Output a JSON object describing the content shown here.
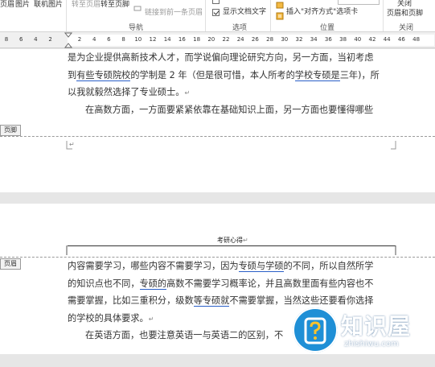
{
  "ribbon": {
    "items": [
      {
        "id": "header",
        "label": "页眉"
      },
      {
        "id": "pic",
        "label": "图片"
      },
      {
        "id": "online_pic",
        "label": "联机图片"
      },
      {
        "id": "goto_header",
        "label": "转至页眉"
      },
      {
        "id": "goto_footer",
        "label": "转至页脚"
      },
      {
        "id": "link_prev",
        "label": "链接到前一条页眉"
      },
      {
        "id": "show_doc_text",
        "label": "显示文档文字"
      },
      {
        "id": "insert_align_tab",
        "label": "插入\"对齐方式\"选项卡"
      },
      {
        "id": "close_label",
        "label": "关闭"
      },
      {
        "id": "close_hf",
        "label": "页眉和页脚"
      }
    ],
    "groups": {
      "navigation": "导航",
      "options": "选项",
      "position": "位置",
      "close": "关闭"
    }
  },
  "ruler": {
    "numbers": [
      "8",
      "6",
      "4",
      "2",
      "",
      "2",
      "4",
      "6",
      "8",
      "10",
      "12",
      "14",
      "16",
      "18",
      "20",
      "22",
      "24",
      "26",
      "28",
      "30",
      "32",
      "34",
      "36",
      "38",
      "40",
      "42",
      "44",
      "46",
      "48"
    ]
  },
  "page1": {
    "lines": [
      {
        "parts": [
          {
            "t": "是为企业提供高新技术人才，而学说偏向理论研究方向，另一方面，当初考虑"
          }
        ]
      },
      {
        "parts": [
          {
            "t": "到"
          },
          {
            "t": "有些专硕院校",
            "u": true
          },
          {
            "t": "的学制是 2 年（但是很可惜，本人所考的"
          },
          {
            "t": "学校专硕是",
            "u": true
          },
          {
            "t": "三年)，所"
          }
        ]
      },
      {
        "parts": [
          {
            "t": "以我就毅然选择了专业硕士。"
          },
          {
            "t": "↵",
            "pm": true
          }
        ]
      },
      {
        "indent": true,
        "parts": [
          {
            "t": "在高数方面，一方面要紧紧依靠在基础知识上面，另一方面也要懂得哪些"
          }
        ]
      }
    ],
    "footer_tab": "页脚"
  },
  "page2": {
    "header_title": "考研心得",
    "header_tab": "页眉",
    "lines": [
      {
        "parts": [
          {
            "t": "内容需要学习，哪些内容不需要学习，因为"
          },
          {
            "t": "专硕与学硕",
            "u": true
          },
          {
            "t": "的不同，所以自然所学"
          }
        ]
      },
      {
        "parts": [
          {
            "t": "的知识点也不同，"
          },
          {
            "t": "专硕的",
            "u": true
          },
          {
            "t": "高数不需要学习概率论，并且高数里面有些内容也不"
          }
        ]
      },
      {
        "parts": [
          {
            "t": "需要掌握，比如三重积分，级数"
          },
          {
            "t": "等专硕就",
            "u": true
          },
          {
            "t": "不需要掌握，当然这些还要看你选择"
          }
        ]
      },
      {
        "parts": [
          {
            "t": "的学校的具体要求。"
          },
          {
            "t": "↵",
            "pm": true
          }
        ]
      },
      {
        "indent": true,
        "parts": [
          {
            "t": "在英语方面，也要注意英语一与英语二的区别，不"
          }
        ]
      }
    ]
  },
  "watermark": {
    "title": "知识屋",
    "url": "zhishiwu.com"
  },
  "colors": {
    "accent": "#1e8fd6",
    "underline": "#2a5fc7"
  }
}
